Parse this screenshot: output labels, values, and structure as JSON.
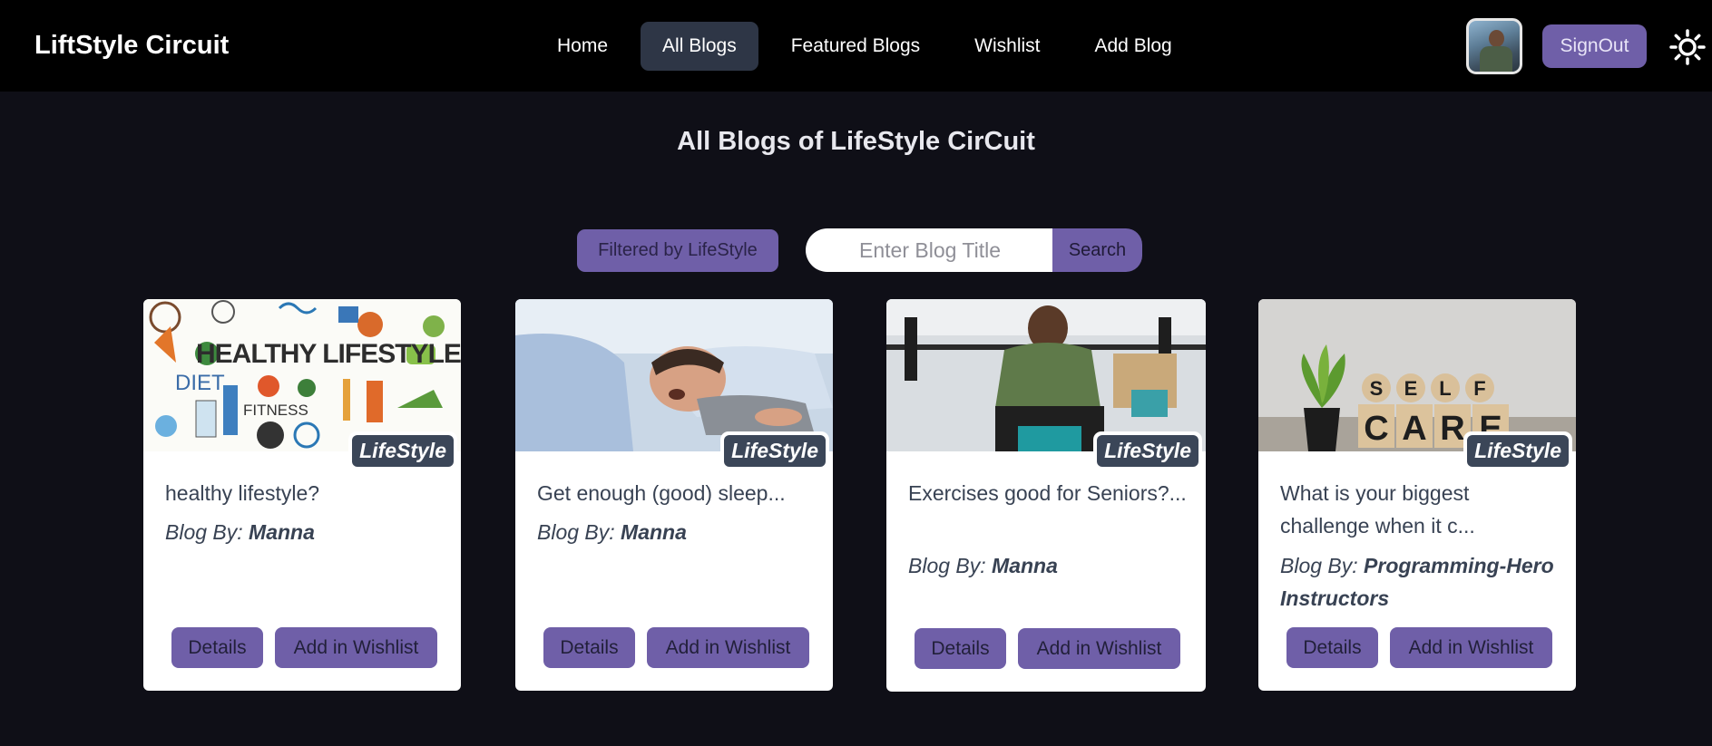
{
  "nav": {
    "brand": "LiftStyle Circuit",
    "links": [
      "Home",
      "All Blogs",
      "Featured Blogs",
      "Wishlist",
      "Add Blog"
    ],
    "active": "All Blogs",
    "signout_label": "SignOut",
    "theme_icon": "sun-icon",
    "avatar_icon": "user-avatar"
  },
  "page": {
    "title": "All Blogs of LifeStyle CirCuit",
    "filter_label": "Filtered by LifeStyle",
    "search_placeholder": "Enter Blog Title",
    "search_label": "Search"
  },
  "cards": [
    {
      "title": "healthy lifestyle?",
      "author_prefix": "Blog By:",
      "author": "Manna",
      "category": "LifeStyle",
      "details_label": "Details",
      "wishlist_label": "Add in Wishlist"
    },
    {
      "title": "Get enough (good) sleep...",
      "author_prefix": "Blog By:",
      "author": "Manna",
      "category": "LifeStyle",
      "details_label": "Details",
      "wishlist_label": "Add in Wishlist"
    },
    {
      "title": "Exercises good for Seniors?...",
      "author_prefix": "Blog By:",
      "author": "Manna",
      "category": "LifeStyle",
      "details_label": "Details",
      "wishlist_label": "Add in Wishlist"
    },
    {
      "title": "What is your biggest challenge when it c...",
      "author_prefix": "Blog By:",
      "author": "Programming-Hero Instructors",
      "category": "LifeStyle",
      "details_label": "Details",
      "wishlist_label": "Add in Wishlist",
      "image_text": [
        "S",
        "E",
        "L",
        "F",
        "C",
        "A",
        "R",
        "E"
      ]
    }
  ],
  "colors": {
    "accent": "#6f5fa8",
    "background": "#0f0f17",
    "navbar": "#000000",
    "active_tab": "#2e3646",
    "badge": "#3b4658"
  }
}
